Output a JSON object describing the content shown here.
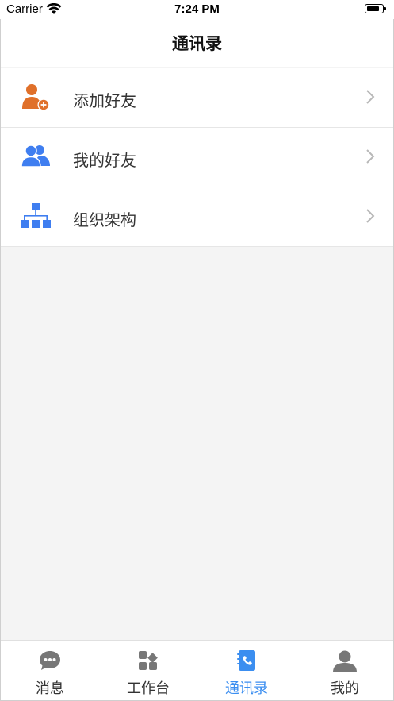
{
  "status_bar": {
    "carrier": "Carrier",
    "time": "7:24 PM"
  },
  "nav": {
    "title": "通讯录"
  },
  "menu": [
    {
      "label": "添加好友",
      "icon": "add-friend-icon",
      "color": "#e0702a"
    },
    {
      "label": "我的好友",
      "icon": "friends-icon",
      "color": "#3f7ef0"
    },
    {
      "label": "组织架构",
      "icon": "org-chart-icon",
      "color": "#3f7ef0"
    }
  ],
  "tabs": [
    {
      "label": "消息",
      "icon": "message-icon",
      "active": false
    },
    {
      "label": "工作台",
      "icon": "workbench-icon",
      "active": false
    },
    {
      "label": "通讯录",
      "icon": "contacts-book-icon",
      "active": true
    },
    {
      "label": "我的",
      "icon": "profile-icon",
      "active": false
    }
  ],
  "colors": {
    "accent": "#3b8ef0",
    "inactive_icon": "#777777",
    "orange": "#e0702a",
    "blue": "#3f7ef0"
  }
}
